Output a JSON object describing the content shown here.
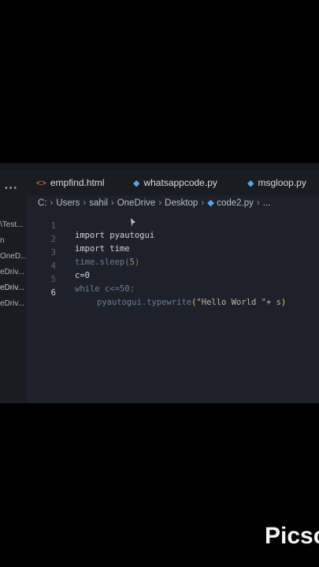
{
  "sidebar": {
    "more_icon": "ellipsis-icon",
    "items": [
      {
        "label": "\\Test..."
      },
      {
        "label": "n"
      },
      {
        "label": "OneD..."
      },
      {
        "label": "eDriv..."
      },
      {
        "label": "eDriv..."
      },
      {
        "label": "eDriv..."
      }
    ]
  },
  "tabs": [
    {
      "label": "empfind.html",
      "icon": "html-file-icon"
    },
    {
      "label": "whatsappcode.py",
      "icon": "python-file-icon"
    },
    {
      "label": "msgloop.py",
      "icon": "python-file-icon"
    }
  ],
  "breadcrumb": {
    "parts": [
      "C:",
      "Users",
      "sahil",
      "OneDrive",
      "Desktop"
    ],
    "file": "code2.py",
    "trail": "..."
  },
  "code": {
    "line_numbers": [
      "1",
      "2",
      "3",
      "4",
      "5",
      "6"
    ],
    "current_line": "6",
    "lines": [
      "import pyautogui",
      "import time",
      "time.sleep(5)",
      "c=0",
      "while c<=50:",
      "pyautogui.typewrite(\"Hello World \"+ s)"
    ],
    "tokens": {
      "l3_a": "time.sleep(",
      "l3_b": "5",
      "l3_c": ")",
      "l5": "while c<=50:",
      "l6_fn": "pyautogui.typewrite",
      "l6_open": "(",
      "l6_str": "\"Hello World \"+ s",
      "l6_close": ")"
    }
  },
  "watermark": "Picsc"
}
